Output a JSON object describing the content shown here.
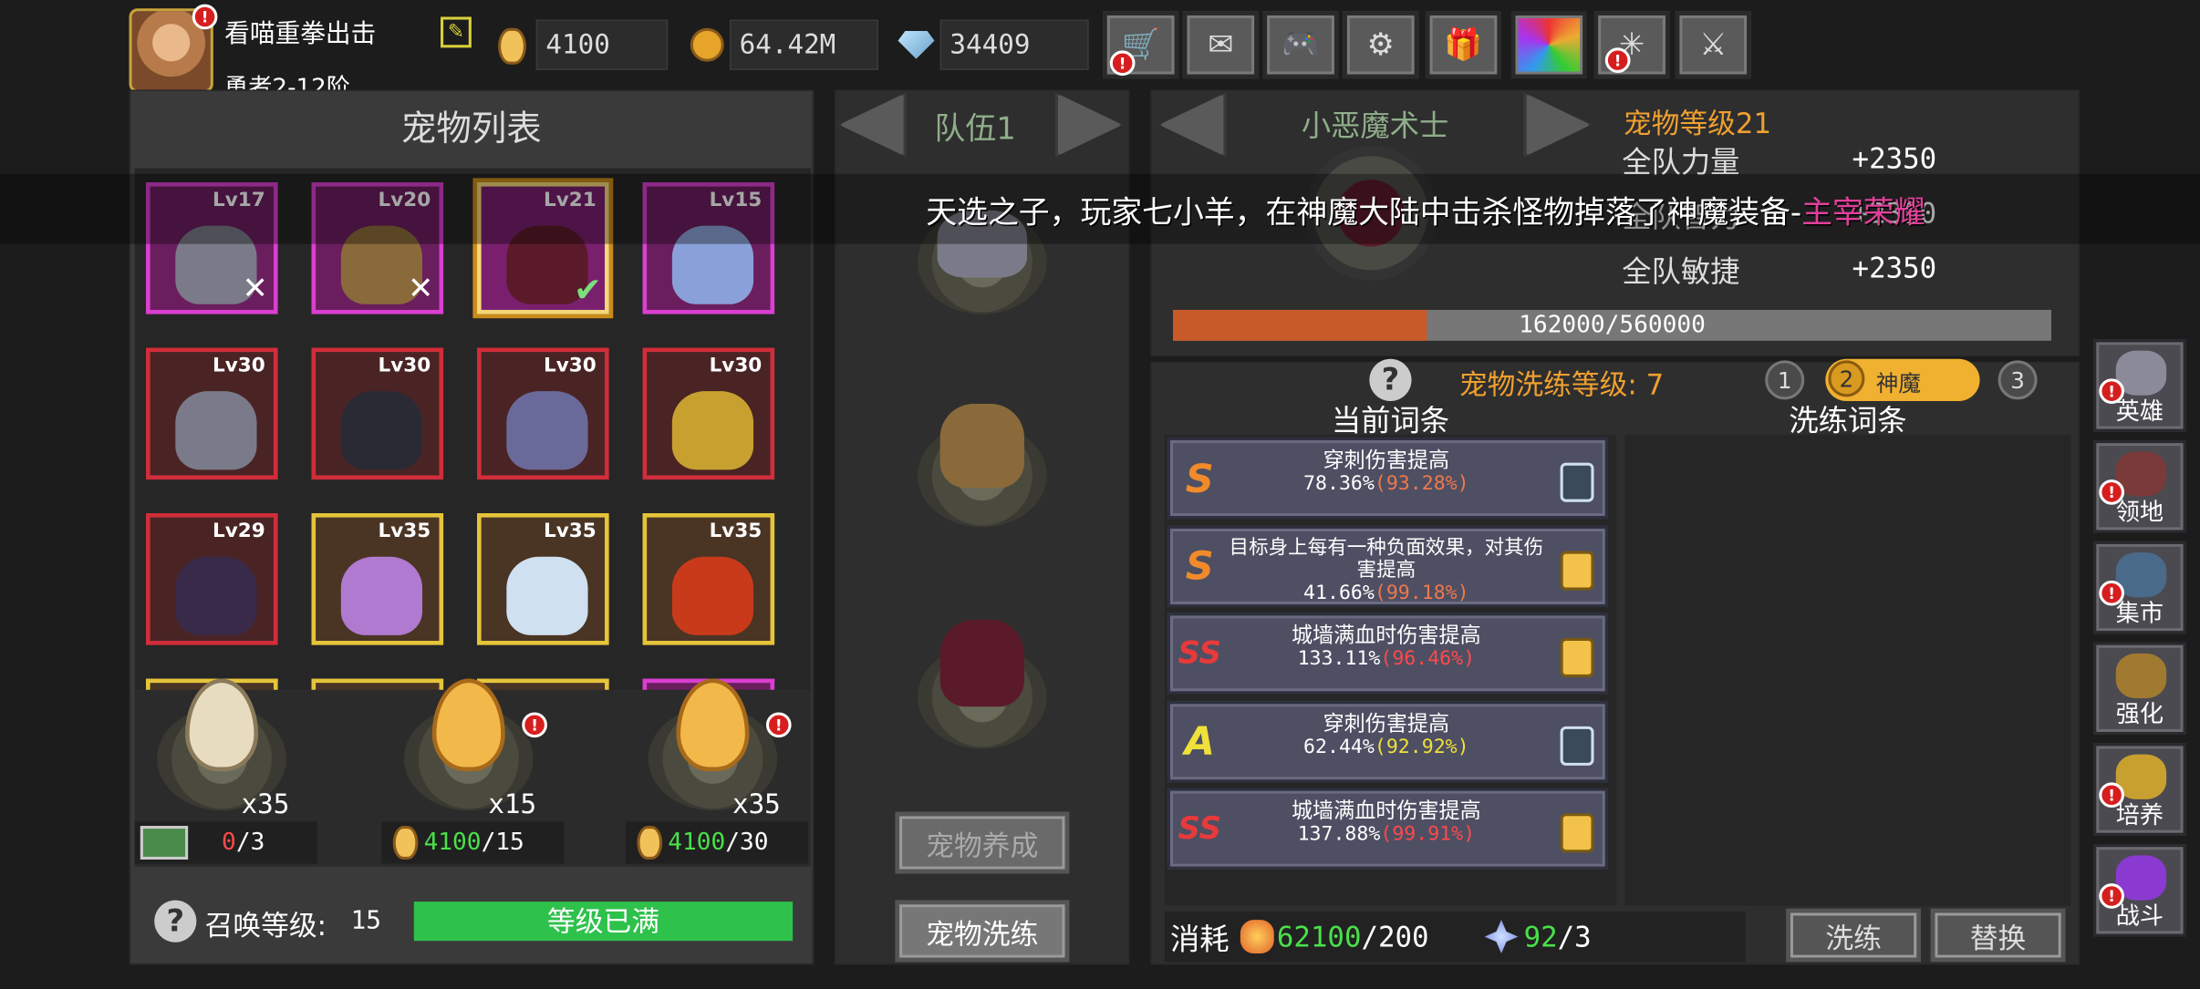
{
  "player": {
    "name": "看喵重拳出击",
    "rank": "勇者2-12阶"
  },
  "resources": {
    "eggs": "4100",
    "gold": "64.42M",
    "gems": "34409"
  },
  "top_buttons": [
    "shop-cart-icon",
    "mail-icon",
    "gamepad-icon",
    "settings-gear-icon",
    "gift-icon",
    "color-wheel-icon",
    "fireworks-icon",
    "crossed-swords-icon"
  ],
  "pet_list": {
    "title": "宠物列表",
    "pets": [
      {
        "level": "Lv17",
        "rarity": "magenta",
        "state": "dismissed"
      },
      {
        "level": "Lv20",
        "rarity": "magenta",
        "state": "dismissed"
      },
      {
        "level": "Lv21",
        "rarity": "magenta",
        "state": "selected"
      },
      {
        "level": "Lv15",
        "rarity": "magenta",
        "state": ""
      },
      {
        "level": "Lv30",
        "rarity": "red",
        "state": ""
      },
      {
        "level": "Lv30",
        "rarity": "red",
        "state": ""
      },
      {
        "level": "Lv30",
        "rarity": "red",
        "state": ""
      },
      {
        "level": "Lv30",
        "rarity": "red",
        "state": ""
      },
      {
        "level": "Lv29",
        "rarity": "red",
        "state": ""
      },
      {
        "level": "Lv35",
        "rarity": "gold",
        "state": ""
      },
      {
        "level": "Lv35",
        "rarity": "gold",
        "state": ""
      },
      {
        "level": "Lv35",
        "rarity": "gold",
        "state": ""
      }
    ]
  },
  "eggs": [
    {
      "count": "x35",
      "cost_cur": "0",
      "cost_max": "/3",
      "cost_type": "ad"
    },
    {
      "count": "x15",
      "cost_cur": "4100",
      "cost_max": "/15",
      "cost_type": "egg"
    },
    {
      "count": "x35",
      "cost_cur": "4100",
      "cost_max": "/30",
      "cost_type": "egg"
    }
  ],
  "summon": {
    "label": "召唤等级:",
    "level": "15",
    "status": "等级已满"
  },
  "team": {
    "title": "队伍1",
    "train_button": "宠物养成",
    "wash_button": "宠物洗练"
  },
  "pet_detail": {
    "name": "小恶魔术士",
    "level_label": "宠物等级21",
    "stats": [
      {
        "name": "全队力量",
        "value": "+2350"
      },
      {
        "name": "全队智力",
        "value": "+2350"
      },
      {
        "name": "全队敏捷",
        "value": "+2350"
      }
    ],
    "exp": "162000/560000",
    "exp_fraction": 0.289
  },
  "broadcast": {
    "text": "天选之子，玩家七小羊，在神魔大陆中击杀怪物掉落了神魔装备-",
    "item": "主宰荣耀"
  },
  "wash": {
    "level_label": "宠物洗练等级: 7",
    "slots": [
      "1",
      "2",
      "3"
    ],
    "active_slot_name": "神魔",
    "current_header": "当前词条",
    "new_header": "洗练词条",
    "affixes": [
      {
        "rank": "S",
        "rank_color": "#f08a2a",
        "text": "穿刺伤害提高",
        "value": "78.36%",
        "max": "(93.28%)",
        "max_color": "#f0784a",
        "locked": false
      },
      {
        "rank": "S",
        "rank_color": "#f08a2a",
        "text": "目标身上每有一种负面效果，对其伤害提高",
        "value": "41.66%",
        "max": "(99.18%)",
        "max_color": "#f0784a",
        "locked": true
      },
      {
        "rank": "SS",
        "rank_color": "#e83a3a",
        "text": "城墙满血时伤害提高",
        "value": "133.11%",
        "max": "(96.46%)",
        "max_color": "#ff4a4a",
        "locked": true
      },
      {
        "rank": "A",
        "rank_color": "#f0e03a",
        "text": "穿刺伤害提高",
        "value": "62.44%",
        "max": "(92.92%)",
        "max_color": "#f0e03a",
        "locked": false
      },
      {
        "rank": "SS",
        "rank_color": "#e83a3a",
        "text": "城墙满血时伤害提高",
        "value": "137.88%",
        "max": "(99.91%)",
        "max_color": "#ff4a4a",
        "locked": true
      }
    ],
    "cost_label": "消耗",
    "cost1_cur": "62100",
    "cost1_max": "/200",
    "cost2_cur": "92",
    "cost2_max": "/3",
    "wash_button": "洗练",
    "replace_button": "替换"
  },
  "side_nav": [
    "英雄",
    "领地",
    "集市",
    "强化",
    "培养",
    "战斗"
  ]
}
